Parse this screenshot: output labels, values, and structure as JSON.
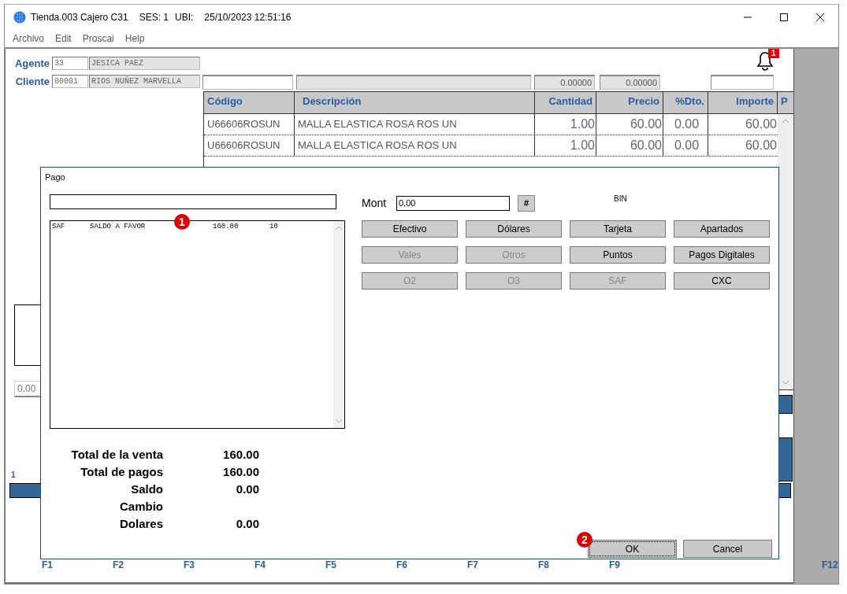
{
  "window": {
    "title": [
      "Tienda.003  Cajero C31",
      "SES: 1",
      "UBI:",
      "25/10/2023 12:51:16"
    ]
  },
  "menu": [
    "Archivo",
    "Edit",
    "Proscai",
    "Help"
  ],
  "notifications": {
    "count": "1"
  },
  "agente": {
    "label": "Agente",
    "code": "33",
    "name": "JESICA PAEZ"
  },
  "cliente": {
    "label": "Cliente",
    "code": "00001",
    "name": "RIOS NUÑEZ MARVELLA"
  },
  "header_fields": [
    {
      "kind": "white"
    },
    {
      "kind": "grey"
    },
    {
      "kind": "grey",
      "value": "0.00000"
    },
    {
      "kind": "grey",
      "value": "0.00000"
    },
    {
      "kind": "white"
    }
  ],
  "table": {
    "columns": [
      "Código",
      "Descripción",
      "Cantidad",
      "Precio",
      "%Dto.",
      "Importe",
      "P"
    ],
    "rows": [
      [
        "U66606ROSUN",
        "MALLA ELASTICA ROSA ROS UN",
        "1.00",
        "60.00",
        "0.00",
        "60.00"
      ],
      [
        "U66606ROSUN",
        "MALLA ELASTICA ROSA ROS UN",
        "1.00",
        "60.00",
        "0.00",
        "60.00"
      ]
    ]
  },
  "left_panel": {
    "amount": "0.00",
    "number": "1"
  },
  "function_keys": [
    "F1",
    "F2",
    "F3",
    "F4",
    "F5",
    "F6",
    "F7",
    "F8",
    "F9",
    "F12"
  ],
  "dialog": {
    "title": "Pago",
    "entries": [
      {
        "code": "SAF",
        "description": "SALDO A FAVOR",
        "amount": "160.00",
        "qty": "10",
        "badge": "1"
      }
    ],
    "mont_label": "Mont",
    "mont_value": "0.00",
    "hash_button": "#",
    "bin_label": "BIN",
    "payment_buttons": [
      {
        "label": "Efectivo",
        "disabled": false
      },
      {
        "label": "Dólares",
        "disabled": false
      },
      {
        "label": "Tarjeta",
        "disabled": false
      },
      {
        "label": "Apartados",
        "disabled": false
      },
      {
        "label": "Vales",
        "disabled": true
      },
      {
        "label": "Otros",
        "disabled": true
      },
      {
        "label": "Puntos",
        "disabled": false
      },
      {
        "label": "Pagos Digitales",
        "disabled": false
      },
      {
        "label": "O2",
        "disabled": true
      },
      {
        "label": "O3",
        "disabled": true
      },
      {
        "label": "SAF",
        "disabled": true
      },
      {
        "label": "CXC",
        "disabled": false
      }
    ],
    "totals": [
      {
        "label": "Total de la venta",
        "value": "160.00"
      },
      {
        "label": "Total de pagos",
        "value": "160.00"
      },
      {
        "label": "Saldo",
        "value": "0.00"
      },
      {
        "label": "Cambio"
      },
      {
        "label": "Dolares",
        "value": "0.00"
      }
    ],
    "ok": {
      "label": "OK",
      "focused": true,
      "badge": "2"
    },
    "cancel": {
      "label": "Cancel",
      "focused": false
    }
  }
}
